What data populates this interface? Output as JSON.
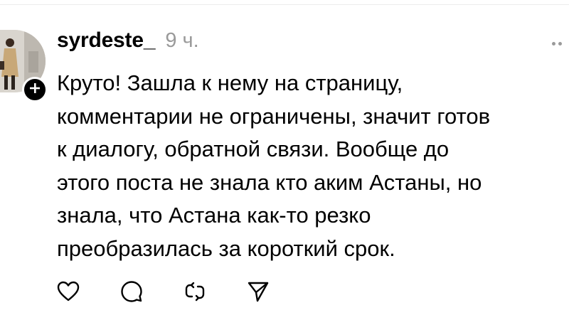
{
  "comment": {
    "username": "syrdeste_",
    "time": "9 ч.",
    "text": "Круто! Зашла к нему на страницу,\nкомментарии не ограничены, значит готов\nк диалогу, обратной связи. Вообще до\nэтого поста не знала кто аким Астаны, но\nзнала, что Астана как-то резко\nпреобразилась за короткий срок."
  },
  "icons": {
    "follow": "plus-icon",
    "more": "more-icon",
    "like": "heart-icon",
    "reply": "speech-bubble-icon",
    "repost": "repost-icon",
    "share": "send-icon"
  },
  "colors": {
    "text": "#000000",
    "muted": "#9a9a9a",
    "badge": "#000000"
  }
}
